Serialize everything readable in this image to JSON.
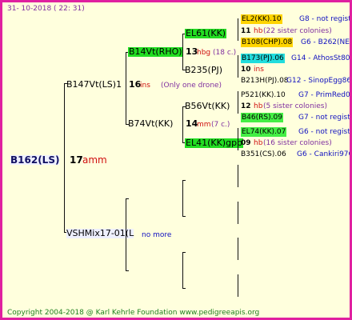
{
  "header": {
    "date": "31- 10-2018 ( 22: 31)"
  },
  "footer": {
    "copyright": "Copyright 2004-2018 @ Karl Kehrle Foundation   www.pedigreeapis.org"
  },
  "root": {
    "name": "B162(LS)",
    "count": "17",
    "unit": "amm"
  },
  "gen1": {
    "father": {
      "name": "B147Vt(LS)1",
      "count": "16",
      "unit": "ins",
      "note": "(Only one drone)"
    },
    "mother": {
      "name": "VSHMix17-01(L",
      "more": "no more"
    }
  },
  "gen2": {
    "ff": {
      "name": "B14Vt(RHO)",
      "count": "13",
      "unit": "hbg",
      "note": "(18 c.)"
    },
    "fm": {
      "name": "B74Vt(KK)",
      "count": "14",
      "unit": "mm",
      "note": "(7 c.)"
    }
  },
  "gen3": {
    "fff": {
      "name": "EL61(KK)"
    },
    "ffm": {
      "name": "B235(PJ)"
    },
    "fmf": {
      "name": "B56Vt(KK)"
    },
    "fmm": {
      "name": "EL41(KK)gpp"
    }
  },
  "gen4": [
    {
      "name": "EL2(KK).10",
      "group": "G8 - not registe",
      "count": "11",
      "unit": "hb",
      "note": "(22 sister colonies)"
    },
    {
      "name": "B108(CHP).08",
      "group": "G6 - B262(NE)"
    },
    {
      "name": "B173(PJ).06",
      "group": "G14 - AthosSt80R",
      "count": "10",
      "unit": "ins"
    },
    {
      "name": "B213H(PJ).08",
      "group": "G12 - SinopEgg86R"
    },
    {
      "name": "P521(KK).10",
      "group": "G7 - PrimRed01",
      "count": "12",
      "unit": "hb",
      "note": "(5 sister colonies)"
    },
    {
      "name": "B46(RS).09",
      "group": "G7 - not registe"
    },
    {
      "name": "EL74(KK).07",
      "group": "G6 - not registe",
      "count": "09",
      "unit": "hb",
      "note": "(16 sister colonies)"
    },
    {
      "name": "B351(CS).06",
      "group": "G6 - Cankiri97Q"
    }
  ]
}
